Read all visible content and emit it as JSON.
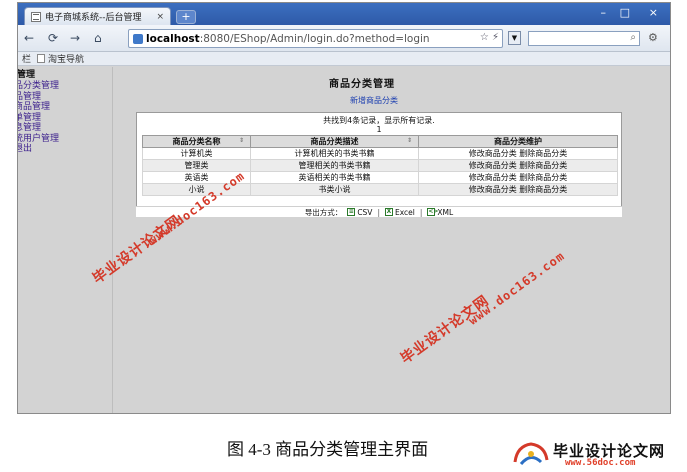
{
  "browser": {
    "tab_title": "电子商城系统--后台管理",
    "tab_close": "×",
    "new_tab": "+",
    "window_controls": {
      "minimize": "–",
      "maximize": "□",
      "close": "×"
    },
    "nav": {
      "back": "←",
      "forward": "→",
      "refresh": "⟳",
      "home": "⌂"
    },
    "url_host": "localhost",
    "url_rest": ":8080/EShop/Admin/login.do?method=login",
    "omnibox_icons": "☆ ⚡",
    "search_value": "",
    "bookmarks": [
      {
        "label": "栏"
      },
      {
        "label": "淘宝导航"
      }
    ]
  },
  "sidebar": {
    "heading": "管理",
    "items": [
      {
        "label": "品分类管理"
      },
      {
        "label": "品管理"
      },
      {
        "label": "商品管理"
      },
      {
        "label": "单管理"
      },
      {
        "label": "息管理"
      },
      {
        "label": "统用户管理"
      },
      {
        "label": "退出"
      }
    ]
  },
  "main": {
    "title": "商品分类管理",
    "new_link": "新增商品分类",
    "count_text": "共找到4条记录，显示所有记录.",
    "page_number": "1",
    "columns": [
      {
        "label": "商品分类名称",
        "sortable": true
      },
      {
        "label": "商品分类描述",
        "sortable": true
      },
      {
        "label": "商品分类维护",
        "sortable": false
      }
    ],
    "rows": [
      {
        "name": "计算机类",
        "desc": "计算机相关的书类书籍",
        "edit": "修改商品分类",
        "delete": "删除商品分类"
      },
      {
        "name": "管理类",
        "desc": "管理相关的书类书籍",
        "edit": "修改商品分类",
        "delete": "删除商品分类"
      },
      {
        "name": "英语类",
        "desc": "英语相关的书类书籍",
        "edit": "修改商品分类",
        "delete": "删除商品分类"
      },
      {
        "name": "小说",
        "desc": "书类小说",
        "edit": "修改商品分类",
        "delete": "删除商品分类"
      }
    ],
    "export": {
      "label": "导出方式：",
      "options": [
        {
          "label": "CSV",
          "icon": "csv-icon"
        },
        {
          "label": "Excel",
          "icon": "excel-icon"
        },
        {
          "label": "XML",
          "icon": "xml-icon"
        }
      ],
      "separator": "|"
    }
  },
  "watermarks": {
    "cn": "毕业设计论文网",
    "url": "www.doc163.com"
  },
  "caption": "图 4-3 商品分类管理主界面",
  "logo": {
    "cn": "毕业设计论文网",
    "url": "www.56doc.com"
  },
  "colors": {
    "watermark": "#d43a2a",
    "link": "#1d3fb0",
    "sidebar_link": "#3b1f8c",
    "tabstrip": "#3c6fc0"
  }
}
